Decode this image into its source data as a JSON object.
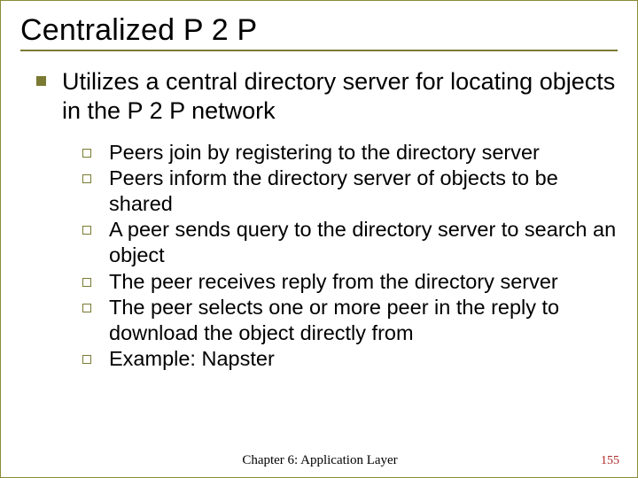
{
  "title": "Centralized P 2 P",
  "main_bullet": "Utilizes a central directory server for locating objects in the P 2 P network",
  "sub_bullets": [
    "Peers join by registering to the directory server",
    "Peers inform the directory server of objects to be shared",
    "A peer sends query to the directory server to search an object",
    "The peer receives reply from the directory server",
    "The peer selects one or more peer in the reply to download the object directly from",
    "Example: Napster"
  ],
  "footer_center": "Chapter 6: Application Layer",
  "footer_right": "155"
}
